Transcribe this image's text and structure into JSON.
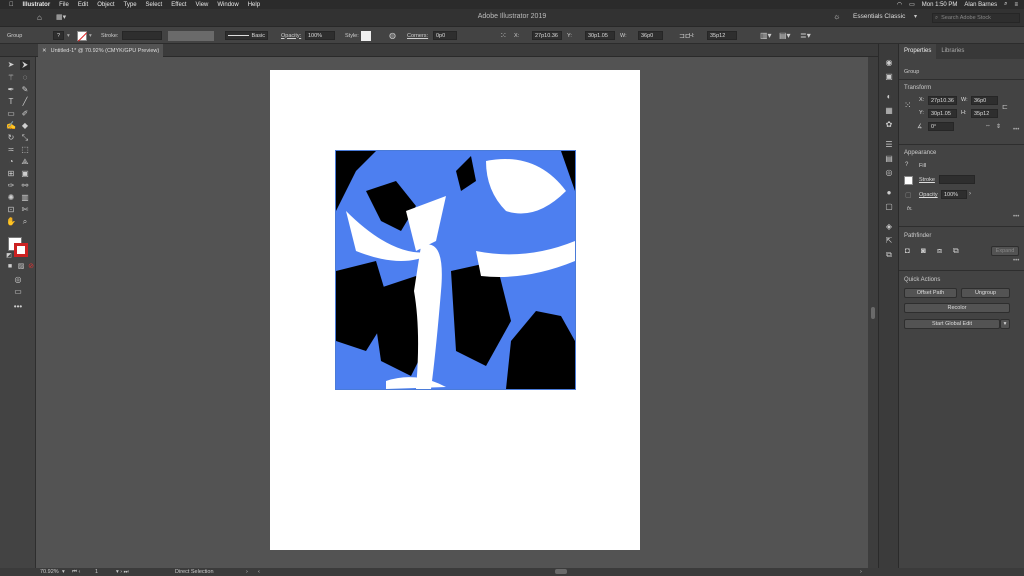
{
  "menubar": {
    "app_name": "Illustrator",
    "items": [
      "File",
      "Edit",
      "Object",
      "Type",
      "Select",
      "Effect",
      "View",
      "Window",
      "Help"
    ],
    "clock": "Mon 1:50 PM",
    "user": "Alan Barnes"
  },
  "appbar": {
    "title": "Adobe Illustrator 2019",
    "workspace": "Essentials Classic",
    "search_placeholder": "Search Adobe Stock"
  },
  "control_bar": {
    "selection": "Group",
    "stroke_label": "Stroke:",
    "brush_label": "Basic",
    "opacity_label": "Opacity:",
    "opacity_value": "100%",
    "style_label": "Style:",
    "corners_label": "Corners:",
    "corners_value": "0p0",
    "x_label": "X:",
    "x_value": "27p10.36",
    "y_label": "Y:",
    "y_value": "30p1.05",
    "w_label": "W:",
    "w_value": "36p0",
    "h_label": "H:",
    "h_value": "35p12"
  },
  "document": {
    "tab_label": "Untitled-1* @ 70.92% (CMYK/GPU Preview)"
  },
  "properties": {
    "tabs": [
      "Properties",
      "Libraries"
    ],
    "selection": "Group",
    "transform_title": "Transform",
    "x_label": "X:",
    "x_value": "27p10.36",
    "y_label": "Y:",
    "y_value": "30p1.05",
    "w_label": "W:",
    "w_value": "36p0",
    "h_label": "H:",
    "h_value": "35p12",
    "angle_value": "0°",
    "appearance_title": "Appearance",
    "fill_label": "Fill",
    "stroke_label": "Stroke",
    "opacity_label": "Opacity",
    "opacity_value": "100%",
    "fx_label": "fx.",
    "pathfinder_title": "Pathfinder",
    "expand_label": "Expand",
    "quick_actions_title": "Quick Actions",
    "offset_path_label": "Offset Path",
    "ungroup_label": "Ungroup",
    "recolor_label": "Recolor",
    "global_edit_label": "Start Global Edit"
  },
  "status": {
    "zoom": "70.92%",
    "artboard": "1",
    "tool": "Direct Selection"
  },
  "colors": {
    "art_blue": "#4d7ff0",
    "art_black": "#000000"
  }
}
